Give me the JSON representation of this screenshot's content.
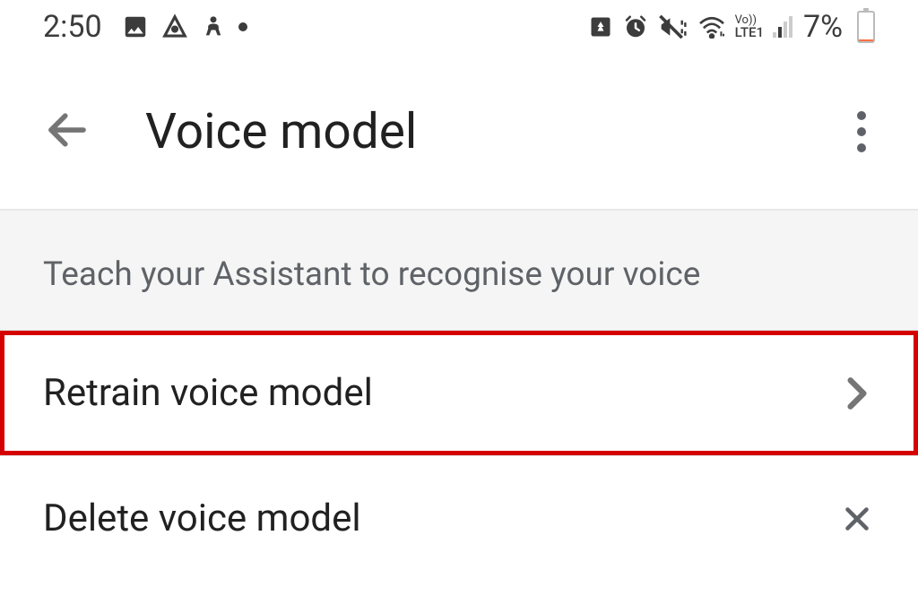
{
  "statusBar": {
    "time": "2:50",
    "batteryPercent": "7%",
    "lte": "LTE1",
    "vo": "Vo))"
  },
  "appBar": {
    "title": "Voice model"
  },
  "section": {
    "header": "Teach your Assistant to recognise your voice"
  },
  "items": {
    "retrain": "Retrain voice model",
    "delete": "Delete voice model"
  }
}
